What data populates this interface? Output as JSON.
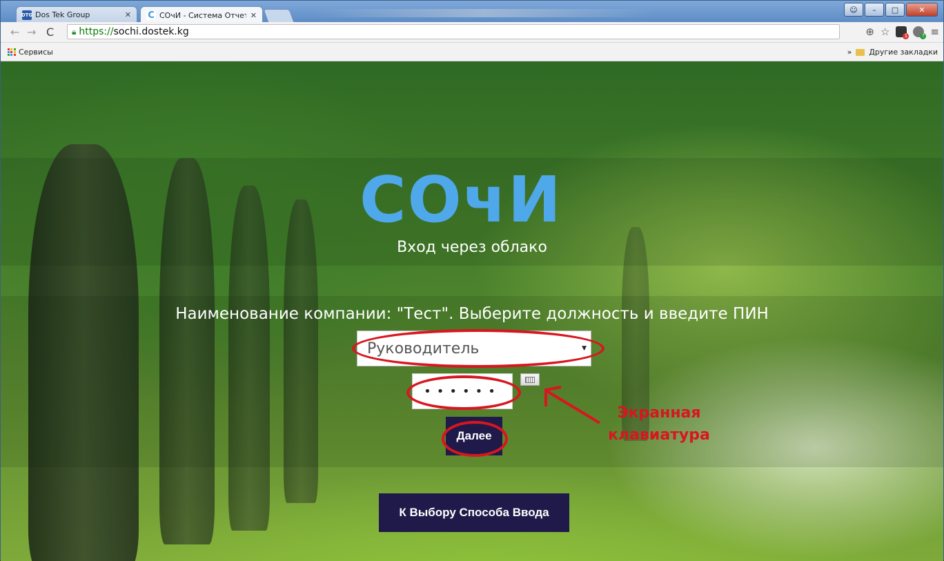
{
  "browser": {
    "tabs": [
      {
        "label": "Dos Tek Group",
        "favicon": "DTG"
      },
      {
        "label": "СОчИ - Система Отчетнс",
        "favicon": "C"
      }
    ],
    "url": {
      "scheme": "https://",
      "host": "sochi.dostek.kg"
    },
    "bookmarks": {
      "apps_label": "Сервисы",
      "other_label": "Другие закладки",
      "more": "»"
    }
  },
  "page": {
    "logo": "СОчИ",
    "subtitle": "Вход через облако",
    "heading": "Наименование компании: \"Тест\". Выберите должность и введите ПИН",
    "role_select": {
      "value": "Руководитель"
    },
    "pin_field": {
      "value": "••••••"
    },
    "next_button": "Далее",
    "back_button": "К Выбору Способа Ввода",
    "annotation": [
      "Экранная",
      "клавиатура"
    ]
  },
  "colors": {
    "logo": "#4fa8ea",
    "button": "#1f1a4a",
    "annotation": "#d8161f"
  }
}
